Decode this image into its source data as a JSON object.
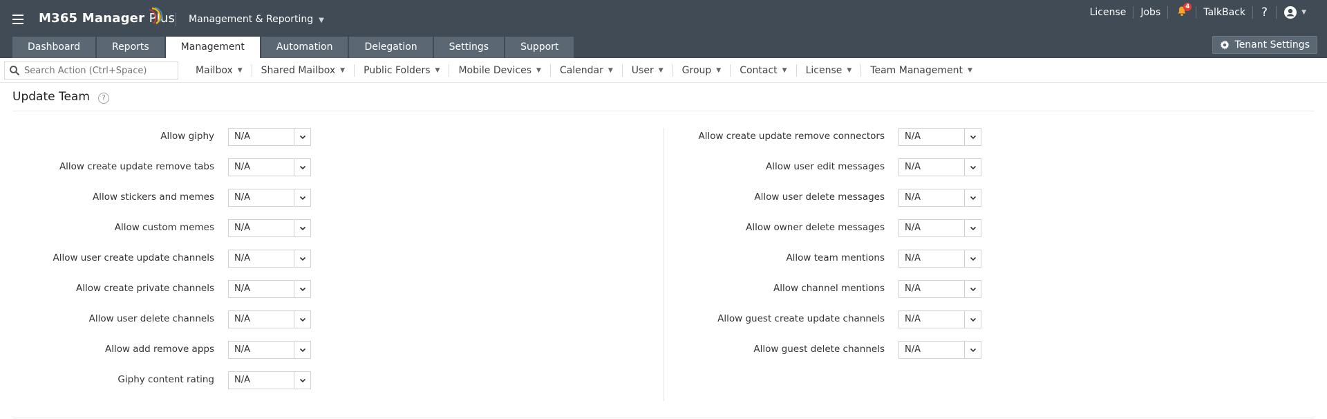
{
  "header": {
    "brand_name": "M365 Manager",
    "brand_plus": "Plus",
    "app_switch_label": "Management & Reporting",
    "links": {
      "license": "License",
      "jobs": "Jobs",
      "talkback": "TalkBack",
      "help": "?"
    },
    "notification_count": "4"
  },
  "nav": {
    "tabs": [
      "Dashboard",
      "Reports",
      "Management",
      "Automation",
      "Delegation",
      "Settings",
      "Support"
    ],
    "active_tab": "Management",
    "tenant_settings_label": "Tenant Settings"
  },
  "subbar": {
    "search_placeholder": "Search Action (Ctrl+Space)",
    "menus": [
      "Mailbox",
      "Shared Mailbox",
      "Public Folders",
      "Mobile Devices",
      "Calendar",
      "User",
      "Group",
      "Contact",
      "License",
      "Team Management"
    ]
  },
  "page": {
    "title": "Update Team",
    "help_icon": "?",
    "left_fields": [
      {
        "label": "Allow giphy",
        "value": "N/A"
      },
      {
        "label": "Allow create update remove tabs",
        "value": "N/A"
      },
      {
        "label": "Allow stickers and memes",
        "value": "N/A"
      },
      {
        "label": "Allow custom memes",
        "value": "N/A"
      },
      {
        "label": "Allow user create update channels",
        "value": "N/A"
      },
      {
        "label": "Allow create private channels",
        "value": "N/A"
      },
      {
        "label": "Allow user delete channels",
        "value": "N/A"
      },
      {
        "label": "Allow add remove apps",
        "value": "N/A"
      },
      {
        "label": "Giphy content rating",
        "value": "N/A"
      }
    ],
    "right_fields": [
      {
        "label": "Allow create update remove connectors",
        "value": "N/A"
      },
      {
        "label": "Allow user edit messages",
        "value": "N/A"
      },
      {
        "label": "Allow user delete messages",
        "value": "N/A"
      },
      {
        "label": "Allow owner delete messages",
        "value": "N/A"
      },
      {
        "label": "Allow team mentions",
        "value": "N/A"
      },
      {
        "label": "Allow channel mentions",
        "value": "N/A"
      },
      {
        "label": "Allow guest create update channels",
        "value": "N/A"
      },
      {
        "label": "Allow guest delete channels",
        "value": "N/A"
      }
    ]
  },
  "colors": {
    "header_bg": "#414b55",
    "tab_bg": "#5b6873",
    "active_tab_bg": "#ffffff",
    "badge": "#e53935"
  },
  "icons": {
    "menu": "hamburger-icon",
    "search": "search-icon",
    "bell": "bell-icon",
    "user": "user-icon",
    "gear": "gear-icon",
    "chevron": "chevron-down-icon"
  }
}
